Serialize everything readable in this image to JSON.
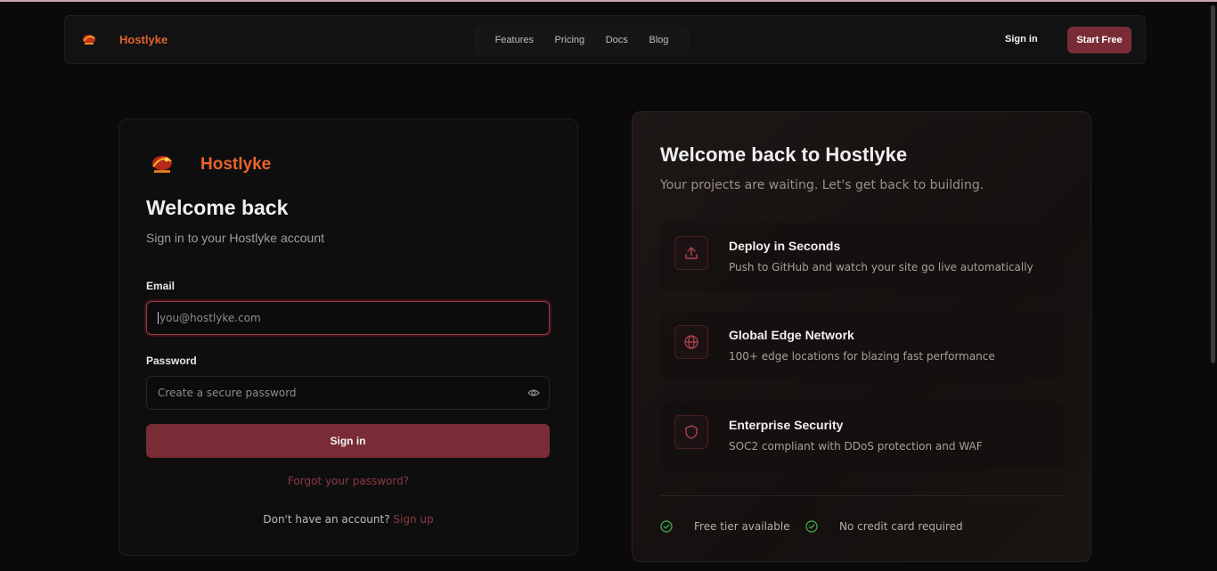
{
  "nav": {
    "brand": "Hostlyke",
    "links": [
      "Features",
      "Pricing",
      "Docs",
      "Blog"
    ],
    "sign_in": "Sign in",
    "start_free": "Start Free"
  },
  "login": {
    "brand": "Hostlyke",
    "title": "Welcome back",
    "subtitle": "Sign in to your Hostlyke account",
    "email_label": "Email",
    "email_placeholder": "you@hostlyke.com",
    "password_label": "Password",
    "password_placeholder": "Create a secure password",
    "submit": "Sign in",
    "forgot": "Forgot your password?",
    "no_account": "Don't have an account?",
    "sign_up": "Sign up"
  },
  "panel": {
    "title": "Welcome back to Hostlyke",
    "subtitle": "Your projects are waiting. Let's get back to building.",
    "features": [
      {
        "title": "Deploy in Seconds",
        "desc": "Push to GitHub and watch your site go live automatically",
        "icon": "upload-icon"
      },
      {
        "title": "Global Edge Network",
        "desc": "100+ edge locations for blazing fast performance",
        "icon": "globe-icon"
      },
      {
        "title": "Enterprise Security",
        "desc": "SOC2 compliant with DDoS protection and WAF",
        "icon": "shield-icon"
      }
    ],
    "badges": [
      "Free tier available",
      "No credit card required"
    ]
  },
  "colors": {
    "brand_orange": "#e8642c",
    "accent": "#7a2c36",
    "link": "#8b3a44",
    "check_green": "#3fb950"
  }
}
